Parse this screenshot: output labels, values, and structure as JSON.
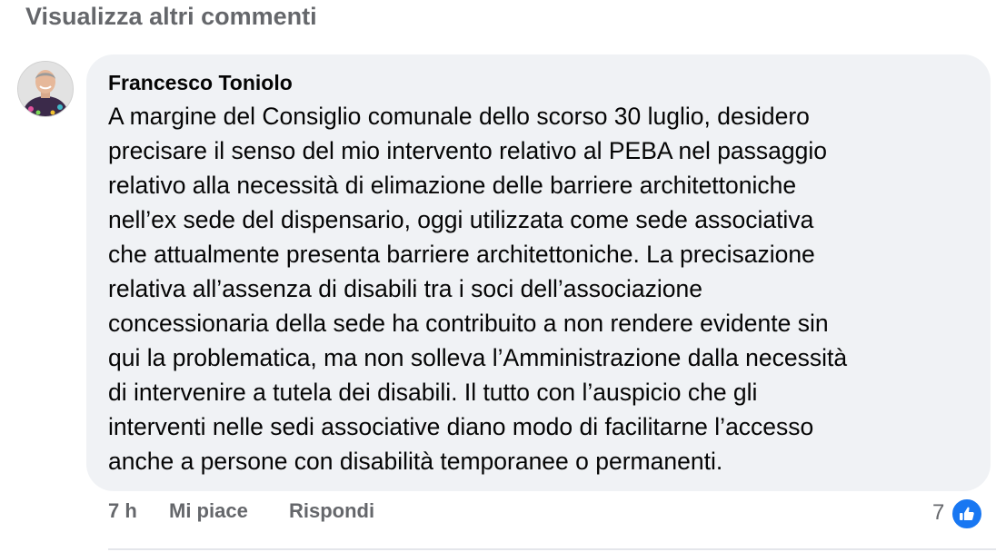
{
  "comments_section": {
    "view_more_label": "Visualizza altri commenti"
  },
  "comment": {
    "avatar_icon": "user-avatar",
    "author": "Francesco Toniolo",
    "text_lines": [
      "A margine del Consiglio comunale dello scorso 30 luglio, desidero",
      "precisare il senso del mio intervento relativo al PEBA nel passaggio",
      "relativo alla necessità di elimazione delle barriere architettoniche",
      "nell’ex sede del dispensario, oggi utilizzata come sede associativa",
      "che attualmente presenta barriere architettoniche. La precisazione",
      "relativa all’assenza di disabili tra i soci dell’associazione",
      "concessionaria della sede ha contribuito a non rendere evidente sin",
      "qui la problematica, ma non solleva l’Amministrazione dalla necessità",
      "di intervenire a tutela dei disabili. Il tutto con l’auspicio che gli",
      "interventi nelle sedi associative diano modo di facilitarne l’accesso",
      "anche a persone con disabilità temporanee o permanenti."
    ],
    "timestamp": "7 h",
    "like_label": "Mi piace",
    "reply_label": "Rispondi",
    "reaction_count": "7",
    "reaction_icon": "thumbs-up-icon",
    "colors": {
      "bubble_bg": "#f0f2f5",
      "secondary_text": "#65676b",
      "like_blue": "#1877f2"
    }
  }
}
